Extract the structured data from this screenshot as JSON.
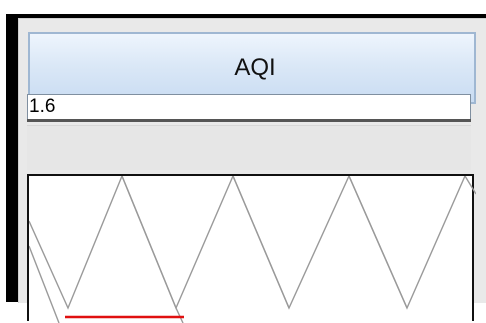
{
  "panel": {
    "title": "AQI",
    "input_value": "1.6"
  },
  "colors": {
    "title_gradient_top": "#eef5fd",
    "title_gradient_bottom": "#c9dcf2",
    "membership_lines": "#9a9a9a",
    "marker_line": "#e01010"
  }
}
